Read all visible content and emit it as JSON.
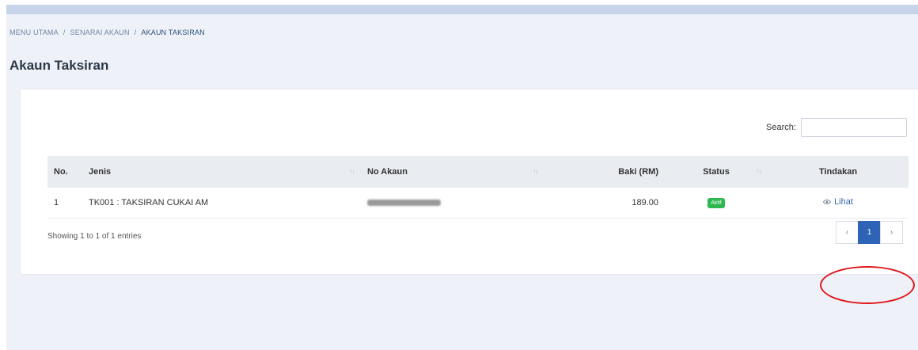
{
  "breadcrumb": {
    "items": [
      "MENU UTAMA",
      "SENARAI AKAUN",
      "AKAUN TAKSIRAN"
    ],
    "separator": "/"
  },
  "page": {
    "title": "Akaun Taksiran"
  },
  "search": {
    "label": "Search:",
    "value": ""
  },
  "table": {
    "headers": {
      "no": "No.",
      "jenis": "Jenis",
      "no_akaun": "No Akaun",
      "baki": "Baki (RM)",
      "status": "Status",
      "tindakan": "Tindakan"
    },
    "sort_icon": "↑↓",
    "rows": [
      {
        "no": "1",
        "jenis": "TK001 : TAKSIRAN CUKAI AM",
        "baki": "189.00",
        "status": "Aktif",
        "action": "Lihat"
      }
    ]
  },
  "info": "Showing 1 to 1 of 1 entries",
  "pagination": {
    "prev": "‹",
    "current": "1",
    "next": "›"
  },
  "colors": {
    "status_active": "#2cb84f",
    "link": "#3465b0",
    "highlight_circle": "#e0161b",
    "page_active": "#2f63b7"
  },
  "icons": {
    "action": "eye-icon"
  }
}
